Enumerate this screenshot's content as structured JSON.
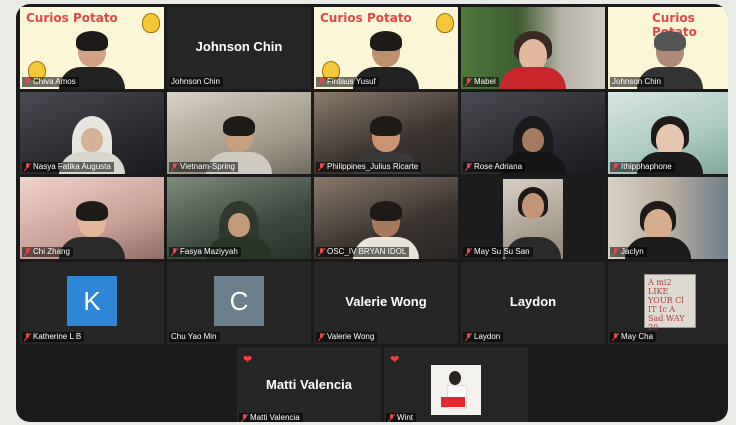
{
  "app": {
    "brand_text": "Curios Potato",
    "banner_subtitle": "Johnson Chin"
  },
  "colors": {
    "frame": "#1a1a1a",
    "tile": "#262626",
    "heart": "#ff3b3b",
    "mic_muted": "#e5484d"
  },
  "participants": [
    {
      "name": "Chiva Amos",
      "type": "video",
      "style": "banner"
    },
    {
      "name": "Johnson Chin",
      "type": "name",
      "display": "Johnson Chin"
    },
    {
      "name": "Firdaus Yusuf",
      "type": "video",
      "style": "banner"
    },
    {
      "name": "Mabel",
      "type": "video",
      "style": "cam-plant"
    },
    {
      "name": "Johnson Chin",
      "type": "video",
      "style": "banner"
    },
    {
      "name": "Nasya Fatika Augusta",
      "type": "video",
      "style": "cam-dark"
    },
    {
      "name": "Vietnam-Spring",
      "type": "video",
      "style": "cam-warm"
    },
    {
      "name": "Philippines_Julius Ricarte",
      "type": "video",
      "style": "cam-warm"
    },
    {
      "name": "Rose Adriana",
      "type": "video",
      "style": "cam-dark"
    },
    {
      "name": "Ithipphaphone",
      "type": "video",
      "style": "cam-light"
    },
    {
      "name": "Chi Zhang",
      "type": "video",
      "style": "cam-pink"
    },
    {
      "name": "Fasya Maziyyah",
      "type": "video",
      "style": "cam-cool"
    },
    {
      "name": "OSC_IV BRYAN IDOL",
      "type": "video",
      "style": "cam-warm"
    },
    {
      "name": "May Su Su San",
      "type": "video",
      "style": "cam-dark"
    },
    {
      "name": "Jaclyn",
      "type": "video",
      "style": "cam-pink"
    },
    {
      "name": "Katherine L B",
      "type": "avatar",
      "initial": "K",
      "color": "#2f86d6"
    },
    {
      "name": "Chu Yao Min",
      "type": "avatar",
      "initial": "C",
      "color": "#6b7f8c"
    },
    {
      "name": "Valerie Wong",
      "type": "name",
      "display": "Valerie Wong"
    },
    {
      "name": "Laydon",
      "type": "name",
      "display": "Laydon"
    },
    {
      "name": "May Cha",
      "type": "book",
      "book_text": "A mi2 LIKE YOUR Cl IT Ic A Sad WAY 20"
    }
  ],
  "bottom_row": [
    {
      "name": "Matti Valencia",
      "type": "name",
      "display": "Matti Valencia",
      "pinned": true
    },
    {
      "name": "Wint",
      "type": "photo",
      "pinned": true
    }
  ]
}
